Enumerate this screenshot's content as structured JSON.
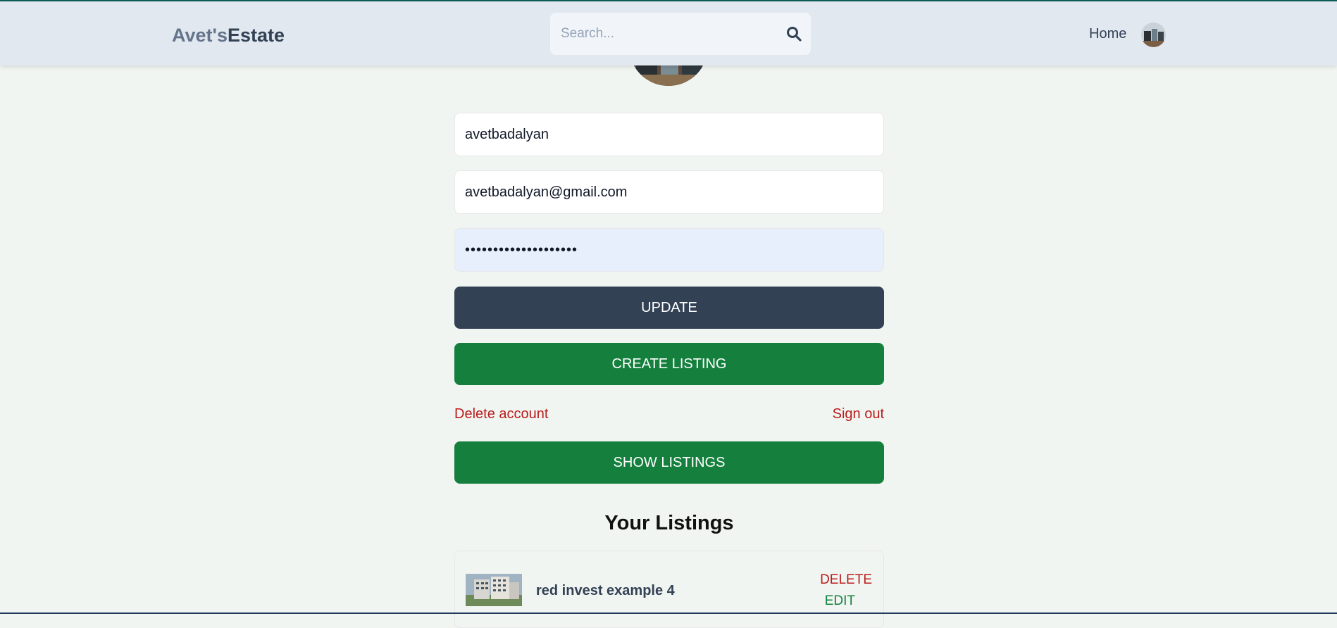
{
  "header": {
    "logo_part1": "Avet's",
    "logo_part2": "Estate",
    "search_placeholder": "Search...",
    "search_icon": "search-icon",
    "nav_home": "Home",
    "avatar_icon": "user-avatar"
  },
  "profile": {
    "avatar_icon": "profile-avatar",
    "username": "avetbadalyan",
    "email": "avetbadalyan@gmail.com",
    "password": "password123456789012"
  },
  "actions": {
    "update_label": "UPDATE",
    "create_listing_label": "CREATE LISTING",
    "delete_account_label": "Delete account",
    "sign_out_label": "Sign out",
    "show_listings_label": "SHOW LISTINGS"
  },
  "listings": {
    "title": "Your Listings",
    "items": [
      {
        "name": "red invest example 4",
        "delete_label": "DELETE",
        "edit_label": "EDIT"
      }
    ]
  },
  "colors": {
    "page_bg": "#f1f5f1",
    "header_bg": "#e2e8f0",
    "dark_button": "#334155",
    "green_button": "#15803d",
    "danger_text": "#b91c1c"
  }
}
